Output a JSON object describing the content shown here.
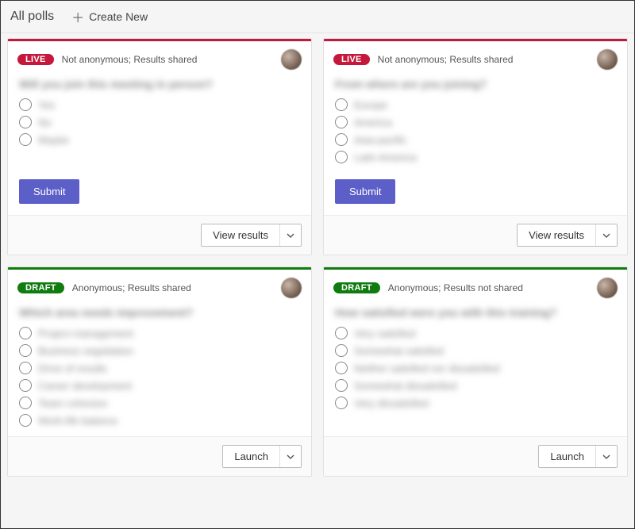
{
  "header": {
    "title": "All polls",
    "create_label": "Create New"
  },
  "badges": {
    "live": "LIVE",
    "draft": "DRAFT"
  },
  "buttons": {
    "submit": "Submit",
    "view_results": "View results",
    "launch": "Launch"
  },
  "polls": [
    {
      "status": "live",
      "meta": "Not anonymous; Results shared",
      "question": "Will you join this meeting in person?",
      "options": [
        "Yes",
        "No",
        "Maybe"
      ],
      "primary_action": "submit",
      "footer_action": "view_results"
    },
    {
      "status": "live",
      "meta": "Not anonymous; Results shared",
      "question": "From where are you joining?",
      "options": [
        "Europe",
        "America",
        "Asia-pacific",
        "Latin America"
      ],
      "primary_action": "submit",
      "footer_action": "view_results"
    },
    {
      "status": "draft",
      "meta": "Anonymous; Results shared",
      "question": "Which area needs improvement?",
      "options": [
        "Project management",
        "Business negotiation",
        "Drive of results",
        "Career development",
        "Team cohesion",
        "Work-life balance"
      ],
      "primary_action": null,
      "footer_action": "launch"
    },
    {
      "status": "draft",
      "meta": "Anonymous; Results not shared",
      "question": "How satisfied were you with this training?",
      "options": [
        "Very satisfied",
        "Somewhat satisfied",
        "Neither satisfied nor dissatisfied",
        "Somewhat dissatisfied",
        "Very dissatisfied"
      ],
      "primary_action": null,
      "footer_action": "launch"
    }
  ]
}
